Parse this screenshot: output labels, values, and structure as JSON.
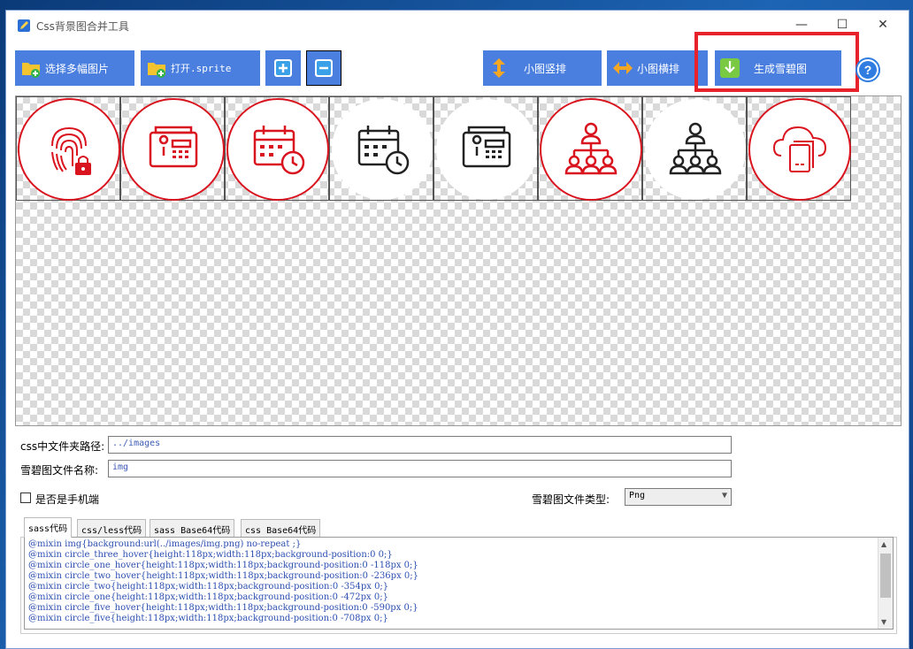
{
  "window": {
    "title": "Css背景图合并工具",
    "minimize": "—",
    "maximize": "☐",
    "close": "✕"
  },
  "toolbar": {
    "select_images": "选择多幅图片",
    "open_sprite": "打开.sprite",
    "vertical": "小图竖排",
    "horizontal": "小图横排",
    "generate": "生成雪碧图"
  },
  "colors": {
    "button_blue": "#4a7fe0",
    "highlight_red": "#e8222a",
    "icon_red": "#d9141e",
    "code_blue": "#2c4fb0"
  },
  "icons": [
    "fingerprint-lock-icon",
    "keypad-device-icon",
    "calendar-clock-icon",
    "calendar-clock-icon",
    "keypad-device-icon",
    "org-chart-icon",
    "org-chart-icon",
    "cloud-document-icon"
  ],
  "form": {
    "folder_label": "css中文件夹路径:",
    "folder_value": "../images",
    "name_label": "雪碧图文件名称:",
    "name_value": "img",
    "mobile_label": "是否是手机端",
    "type_label": "雪碧图文件类型:",
    "type_value": "Png"
  },
  "tabs": [
    "sass代码",
    "css/less代码",
    "sass Base64代码",
    "css Base64代码"
  ],
  "code": [
    "@mixin img{background:url(../images/img.png) no-repeat ;}",
    "@mixin circle_three_hover{height:118px;width:118px;background-position:0 0;}",
    "@mixin circle_one_hover{height:118px;width:118px;background-position:0 -118px 0;}",
    "@mixin circle_two_hover{height:118px;width:118px;background-position:0 -236px 0;}",
    "@mixin circle_two{height:118px;width:118px;background-position:0 -354px 0;}",
    "@mixin circle_one{height:118px;width:118px;background-position:0 -472px 0;}",
    "@mixin circle_five_hover{height:118px;width:118px;background-position:0 -590px 0;}",
    "@mixin circle_five{height:118px;width:118px;background-position:0 -708px 0;}"
  ]
}
